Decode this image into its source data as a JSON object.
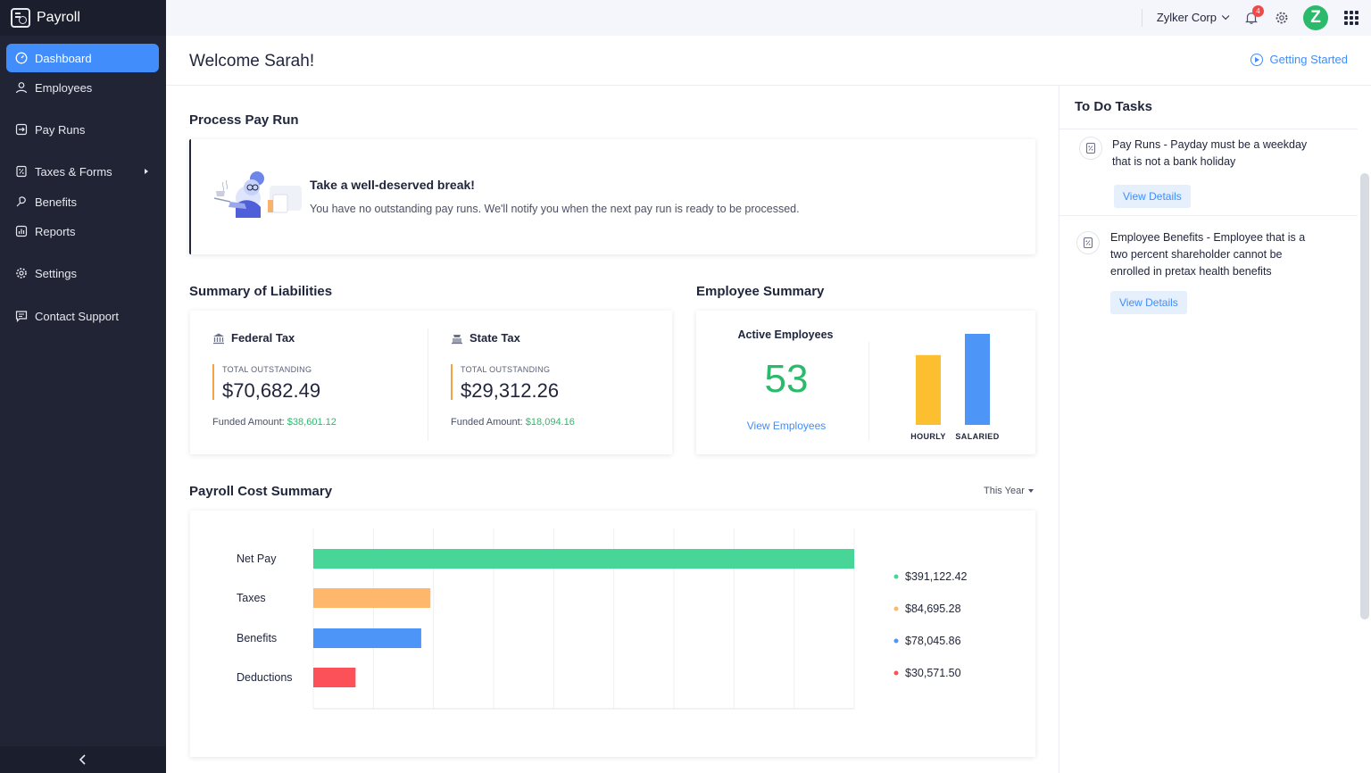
{
  "app": {
    "name": "Payroll"
  },
  "sidebar": {
    "items": [
      {
        "label": "Dashboard",
        "icon": "dashboard-icon",
        "active": true
      },
      {
        "label": "Employees",
        "icon": "user-icon"
      },
      {
        "label": "Pay Runs",
        "icon": "payrun-icon"
      },
      {
        "label": "Taxes & Forms",
        "icon": "percent-doc-icon",
        "has_submenu": true
      },
      {
        "label": "Benefits",
        "icon": "benefits-icon"
      },
      {
        "label": "Reports",
        "icon": "reports-icon"
      },
      {
        "label": "Settings",
        "icon": "gear-icon"
      },
      {
        "label": "Contact Support",
        "icon": "chat-icon"
      }
    ]
  },
  "topbar": {
    "org_name": "Zylker Corp",
    "notification_count": "4",
    "avatar_letter": "Z"
  },
  "header": {
    "welcome": "Welcome Sarah!",
    "getting_started": "Getting Started"
  },
  "process_pay_run": {
    "title": "Process Pay Run",
    "heading": "Take a well-deserved break!",
    "message": "You have no outstanding pay runs. We'll notify you when the next pay run is ready to be processed."
  },
  "liabilities": {
    "title": "Summary of Liabilities",
    "federal": {
      "label": "Federal Tax",
      "caption": "TOTAL OUTSTANDING",
      "amount": "$70,682.49",
      "funded_label": "Funded Amount:",
      "funded_value": "$38,601.12"
    },
    "state": {
      "label": "State Tax",
      "caption": "TOTAL OUTSTANDING",
      "amount": "$29,312.26",
      "funded_label": "Funded Amount:",
      "funded_value": "$18,094.16"
    }
  },
  "employee_summary": {
    "title": "Employee Summary",
    "active_label": "Active Employees",
    "active_count": "53",
    "view_link": "View Employees",
    "chart": {
      "categories": [
        "HOURLY",
        "SALARIED"
      ],
      "values": [
        23,
        30
      ],
      "colors": [
        "#fbbf2f",
        "#4e95f8"
      ]
    }
  },
  "payroll_cost": {
    "title": "Payroll Cost Summary",
    "period": "This Year"
  },
  "chart_data": {
    "type": "bar",
    "orientation": "horizontal",
    "categories": [
      "Net Pay",
      "Taxes",
      "Benefits",
      "Deductions"
    ],
    "values": [
      391122.42,
      84695.28,
      78045.86,
      30571.5
    ],
    "display_values": [
      "$391,122.42",
      "$84,695.28",
      "$78,045.86",
      "$30,571.50"
    ],
    "colors": [
      "#47d598",
      "#ffb76b",
      "#4e95f8",
      "#fd5159"
    ],
    "legend_position": "right",
    "grid": true
  },
  "todo": {
    "title": "To Do Tasks",
    "tasks": [
      {
        "text": "Pay Runs - Payday must be a weekday that is not a bank holiday",
        "action": "View Details"
      },
      {
        "text": "Employee Benefits - Employee that is a two percent shareholder cannot be enrolled in pretax health benefits",
        "action": "View Details"
      }
    ]
  }
}
